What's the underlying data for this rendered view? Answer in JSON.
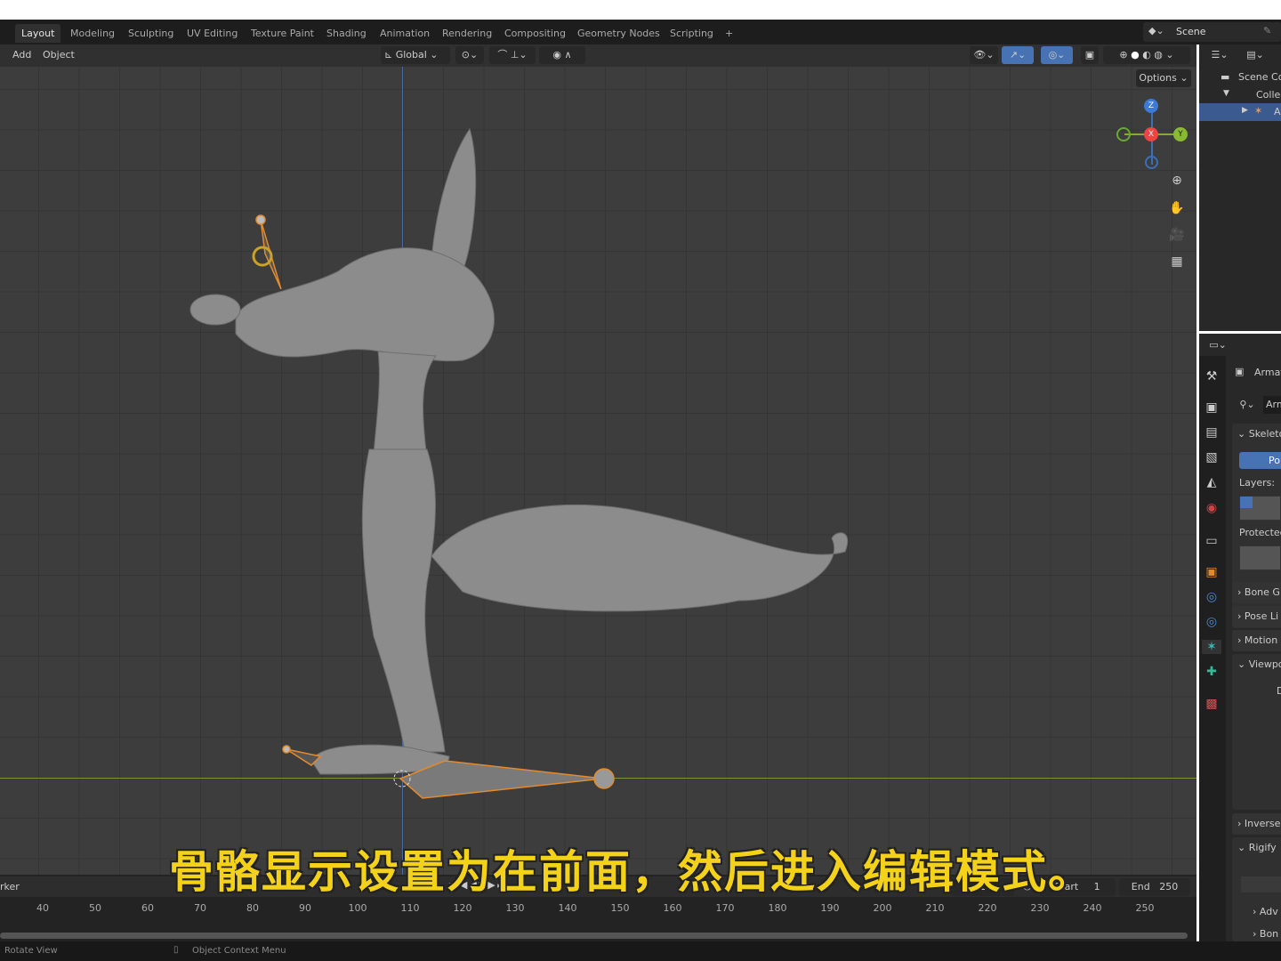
{
  "workspace_tabs": [
    "Layout",
    "Modeling",
    "Sculpting",
    "UV Editing",
    "Texture Paint",
    "Shading",
    "Animation",
    "Rendering",
    "Compositing",
    "Geometry Nodes",
    "Scripting",
    "+"
  ],
  "scene_name": "Scene",
  "viewport_header": {
    "menus": [
      "Add",
      "Object"
    ],
    "orientation": "Global",
    "options": "Options"
  },
  "gizmo": {
    "z": "Z",
    "x": "X",
    "y": "Y"
  },
  "outliner": {
    "items": [
      "Scene Col",
      "Collec",
      "A"
    ]
  },
  "properties": {
    "object": "Armat",
    "data": "Arm",
    "skeleton": "Skeleto",
    "pose_btn": "Po",
    "layers": "Layers:",
    "protected": "Protected",
    "panels": [
      "Bone G",
      "Pose Li",
      "Motion",
      "Viewpo",
      "Inverse",
      "Rigify"
    ],
    "viewport_d": "D",
    "sub": [
      "Adv",
      "Bon"
    ]
  },
  "timeline": {
    "marker": "rker",
    "current_frame": "1",
    "start_label": "Start",
    "start": "1",
    "end_label": "End",
    "end": "250",
    "ticks": [
      "40",
      "50",
      "60",
      "70",
      "80",
      "90",
      "100",
      "110",
      "120",
      "130",
      "140",
      "150",
      "160",
      "170",
      "180",
      "190",
      "200",
      "210",
      "220",
      "230",
      "240",
      "250"
    ]
  },
  "status": {
    "left": "Rotate View",
    "mid": "Object Context Menu"
  },
  "subtitle": "骨骼显示设置为在前面，然后进入编辑模式。"
}
